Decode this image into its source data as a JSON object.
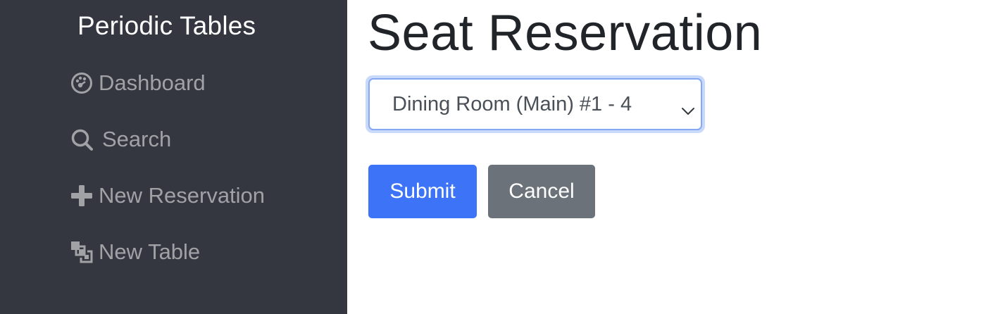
{
  "sidebar": {
    "brand": "Periodic Tables",
    "items": [
      {
        "label": "Dashboard",
        "icon": "dashboard-icon"
      },
      {
        "label": "Search",
        "icon": "search-icon"
      },
      {
        "label": "New Reservation",
        "icon": "plus-icon"
      },
      {
        "label": "New Table",
        "icon": "layers-icon"
      }
    ]
  },
  "main": {
    "title": "Seat Reservation",
    "table_select": {
      "selected": "Dining Room (Main) #1 - 4",
      "icon": "chevron-down-icon"
    },
    "submit_label": "Submit",
    "cancel_label": "Cancel"
  },
  "colors": {
    "sidebar_bg": "#343640",
    "primary": "#3d73f7",
    "secondary": "#6b727a",
    "focus_ring": "#c8d9fb"
  }
}
